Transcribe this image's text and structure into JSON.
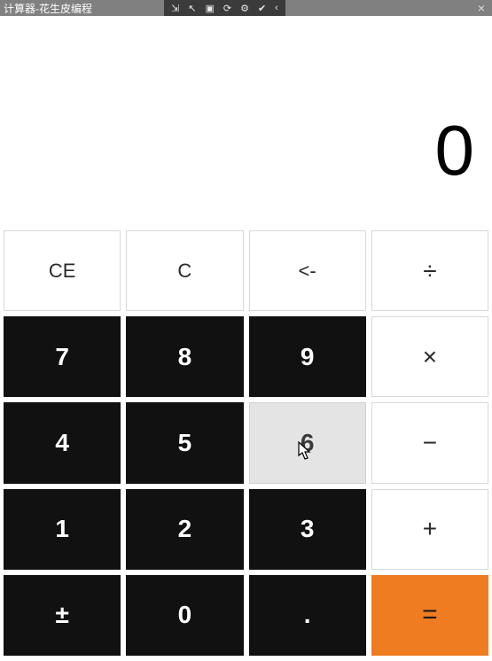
{
  "window": {
    "title": "计算器-花生皮编程",
    "close_glyph": "×"
  },
  "toolbar": {
    "icons": [
      "export-icon",
      "pointer-icon",
      "screenshot-icon",
      "refresh-icon",
      "settings-icon",
      "check-icon",
      "back-icon"
    ],
    "glyphs": [
      "⇲",
      "↖",
      "▣",
      "⟳",
      "⚙",
      "✔",
      "‹"
    ]
  },
  "display": {
    "value": "0"
  },
  "keys": {
    "ce": "CE",
    "c": "C",
    "back": "<-",
    "div": "÷",
    "k7": "7",
    "k8": "8",
    "k9": "9",
    "mul": "×",
    "k4": "4",
    "k5": "5",
    "k6": "6",
    "sub": "−",
    "k1": "1",
    "k2": "2",
    "k3": "3",
    "add": "+",
    "pm": "±",
    "k0": "0",
    "dot": ".",
    "eq": "="
  }
}
